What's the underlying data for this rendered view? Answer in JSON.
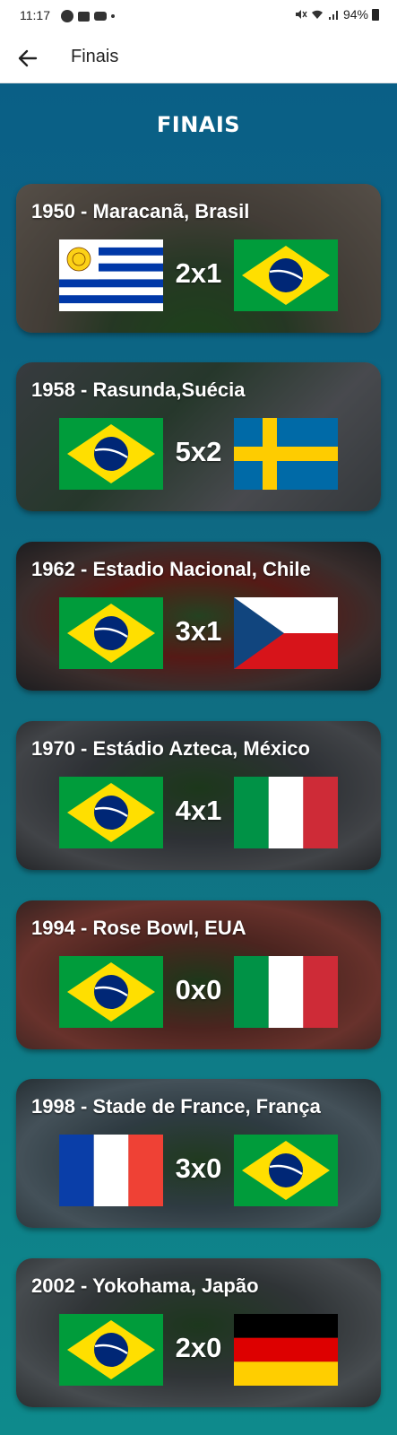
{
  "status_bar": {
    "time": "11:17",
    "battery": "94%"
  },
  "app_bar": {
    "title": "Finais"
  },
  "heading": "FINAIS",
  "colors": {
    "header_bg": "#ffffff",
    "content_gradient_top": "#0a5f86",
    "content_gradient_bottom": "#0e8a8c"
  },
  "finals": [
    {
      "title": "1950 - Maracanã, Brasil",
      "score": "2x1",
      "left_flag": "uruguay-flag",
      "right_flag": "brazil-flag"
    },
    {
      "title": "1958 - Rasunda,Suécia",
      "score": "5x2",
      "left_flag": "brazil-flag",
      "right_flag": "sweden-flag"
    },
    {
      "title": "1962 - Estadio Nacional, Chile",
      "score": "3x1",
      "left_flag": "brazil-flag",
      "right_flag": "czechoslovakia-flag"
    },
    {
      "title": "1970 - Estádio Azteca, México",
      "score": "4x1",
      "left_flag": "brazil-flag",
      "right_flag": "italy-flag"
    },
    {
      "title": "1994 - Rose Bowl, EUA",
      "score": "0x0",
      "left_flag": "brazil-flag",
      "right_flag": "italy-flag"
    },
    {
      "title": "1998 - Stade de France, França",
      "score": "3x0",
      "left_flag": "france-flag",
      "right_flag": "brazil-flag"
    },
    {
      "title": "2002 - Yokohama, Japão",
      "score": "2x0",
      "left_flag": "brazil-flag",
      "right_flag": "germany-flag"
    }
  ]
}
